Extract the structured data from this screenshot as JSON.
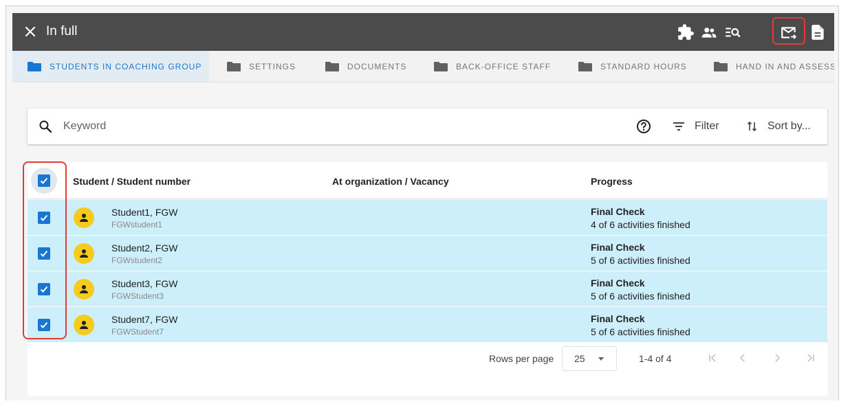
{
  "appbar": {
    "title": "In full",
    "icons": [
      "puzzle-icon",
      "people-icon",
      "list-search-icon",
      "mail-forward-icon",
      "document-icon"
    ]
  },
  "tabs": [
    {
      "label": "STUDENTS IN COACHING GROUP",
      "active": true
    },
    {
      "label": "SETTINGS",
      "active": false
    },
    {
      "label": "DOCUMENTS",
      "active": false
    },
    {
      "label": "BACK-OFFICE STAFF",
      "active": false
    },
    {
      "label": "STANDARD HOURS",
      "active": false
    },
    {
      "label": "HAND IN AND ASSESS",
      "active": false
    }
  ],
  "search": {
    "placeholder": "Keyword",
    "filter_label": "Filter",
    "sort_label": "Sort by..."
  },
  "table": {
    "columns": [
      "Student / Student number",
      "At organization / Vacancy",
      "Progress"
    ],
    "rows": [
      {
        "name": "Student1, FGW",
        "number": "FGWstudent1",
        "progress_title": "Final Check",
        "progress_detail": "4 of 6 activities finished"
      },
      {
        "name": "Student2, FGW",
        "number": "FGWstudent2",
        "progress_title": "Final Check",
        "progress_detail": "5 of 6 activities finished"
      },
      {
        "name": "Student3, FGW",
        "number": "FGWStudent3",
        "progress_title": "Final Check",
        "progress_detail": "5 of 6 activities finished"
      },
      {
        "name": "Student7, FGW",
        "number": "FGWStudent7",
        "progress_title": "Final Check",
        "progress_detail": "5 of 6 activities finished"
      }
    ]
  },
  "pagination": {
    "rows_per_page_label": "Rows per page",
    "rows_per_page": "25",
    "range": "1-4 of 4"
  },
  "colors": {
    "appbar": "#4b4b4b",
    "accent": "#1976d2",
    "row_selected": "#cdeefb",
    "avatar": "#f5cc1e",
    "highlight": "#e53935"
  }
}
